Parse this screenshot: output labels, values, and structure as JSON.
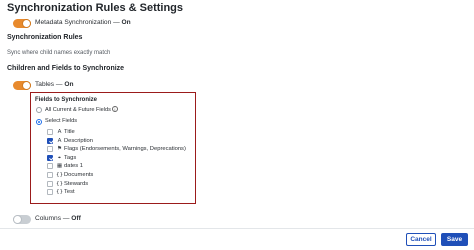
{
  "page": {
    "title": "Synchronization Rules & Settings"
  },
  "metadata_sync": {
    "label": "Metadata Synchronization",
    "separator": " — ",
    "state": "On",
    "enabled": true
  },
  "sync_rules": {
    "heading": "Synchronization Rules",
    "description": "Sync where child names exactly match"
  },
  "children_fields": {
    "heading": "Children and Fields to Synchronize"
  },
  "tables_toggle": {
    "label": "Tables",
    "separator": " — ",
    "state": "On",
    "enabled": true
  },
  "fields_panel": {
    "title": "Fields to Synchronize",
    "options": [
      {
        "label": "All Current & Future Fields",
        "selected": false,
        "info_icon": "info-icon"
      },
      {
        "label": "Select Fields",
        "selected": true
      }
    ],
    "fields": [
      {
        "name": "Title",
        "checked": false,
        "icon": "text-type-icon",
        "glyph": "A"
      },
      {
        "name": "Description",
        "checked": true,
        "icon": "rich-text-type-icon",
        "glyph": "A"
      },
      {
        "name": "Flags (Endorsements, Warnings, Deprecations)",
        "checked": false,
        "icon": "flag-icon",
        "glyph": "⚑"
      },
      {
        "name": "Tags",
        "checked": true,
        "icon": "tag-icon",
        "glyph": "⌖"
      },
      {
        "name": "dates 1",
        "checked": false,
        "icon": "calendar-icon",
        "glyph": "▦"
      },
      {
        "name": "Documents",
        "checked": false,
        "icon": "object-braces-icon",
        "glyph": "{}"
      },
      {
        "name": "Stewards",
        "checked": false,
        "icon": "object-braces-icon",
        "glyph": "{}"
      },
      {
        "name": "Test",
        "checked": false,
        "icon": "object-braces-icon",
        "glyph": "{}"
      }
    ]
  },
  "columns_toggle": {
    "label": "Columns",
    "separator": " — ",
    "state": "Off",
    "enabled": false
  },
  "footer": {
    "cancel_label": "Cancel",
    "save_label": "Save"
  },
  "colors": {
    "accent": "#e88a2d",
    "primary": "#1f4fb8",
    "highlight_border": "#9b1b1b"
  }
}
